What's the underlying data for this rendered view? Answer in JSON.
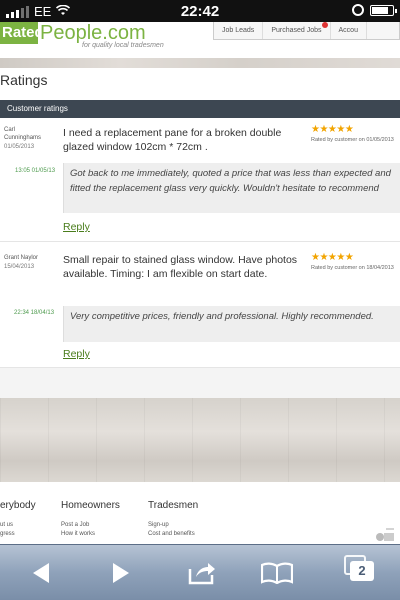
{
  "status_bar": {
    "carrier": "EE",
    "time": "22:42",
    "battery_level": 0.8
  },
  "header": {
    "logo_left": "Rated",
    "logo_right": "People.com",
    "tagline": "for quality local tradesmen",
    "nav": [
      "Job Leads",
      "Purchased Jobs",
      "Accou"
    ]
  },
  "page": {
    "title": "Ratings",
    "section_title": "Customer ratings"
  },
  "reviews": [
    {
      "reviewer_line1": "Carl",
      "reviewer_line2": "Cunninghams",
      "date": "01/05/2013",
      "job": "I need a replacement pane for a broken double glazed window 102cm * 72cm .",
      "stars": "★★★★★",
      "rated_by": "Rated by customer on 01/05/2013",
      "comment_time": "13:05 01/05/13",
      "comment": "Got back to me immediately, quoted a price that was less than expected and fitted the replacement glass very quickly. Wouldn't hesitate to recommend",
      "reply": "Reply"
    },
    {
      "reviewer_line1": "Grant Naylor",
      "reviewer_line2": "",
      "date": "15/04/2013",
      "job": "Small repair to stained glass window. Have photos available. Timing: I am flexible on start date.",
      "stars": "★★★★★",
      "rated_by": "Rated by customer on 18/04/2013",
      "comment_time": "22:34 18/04/13",
      "comment": "Very competitive prices, friendly and professional. Highly recommended.",
      "reply": "Reply"
    }
  ],
  "footer": {
    "columns": [
      {
        "heading": "erybody",
        "links": [
          "ut us",
          "gress"
        ]
      },
      {
        "heading": "Homeowners",
        "links": [
          "Post a Job",
          "How it works"
        ]
      },
      {
        "heading": "Tradesmen",
        "links": [
          "Sign-up",
          "Cost and benefits"
        ]
      }
    ]
  },
  "toolbar": {
    "tab_count": "2"
  },
  "colors": {
    "accent_green": "#7cb342",
    "section_bar": "#3d4752",
    "link_green": "#4a7d1c",
    "star": "#f2a400"
  }
}
